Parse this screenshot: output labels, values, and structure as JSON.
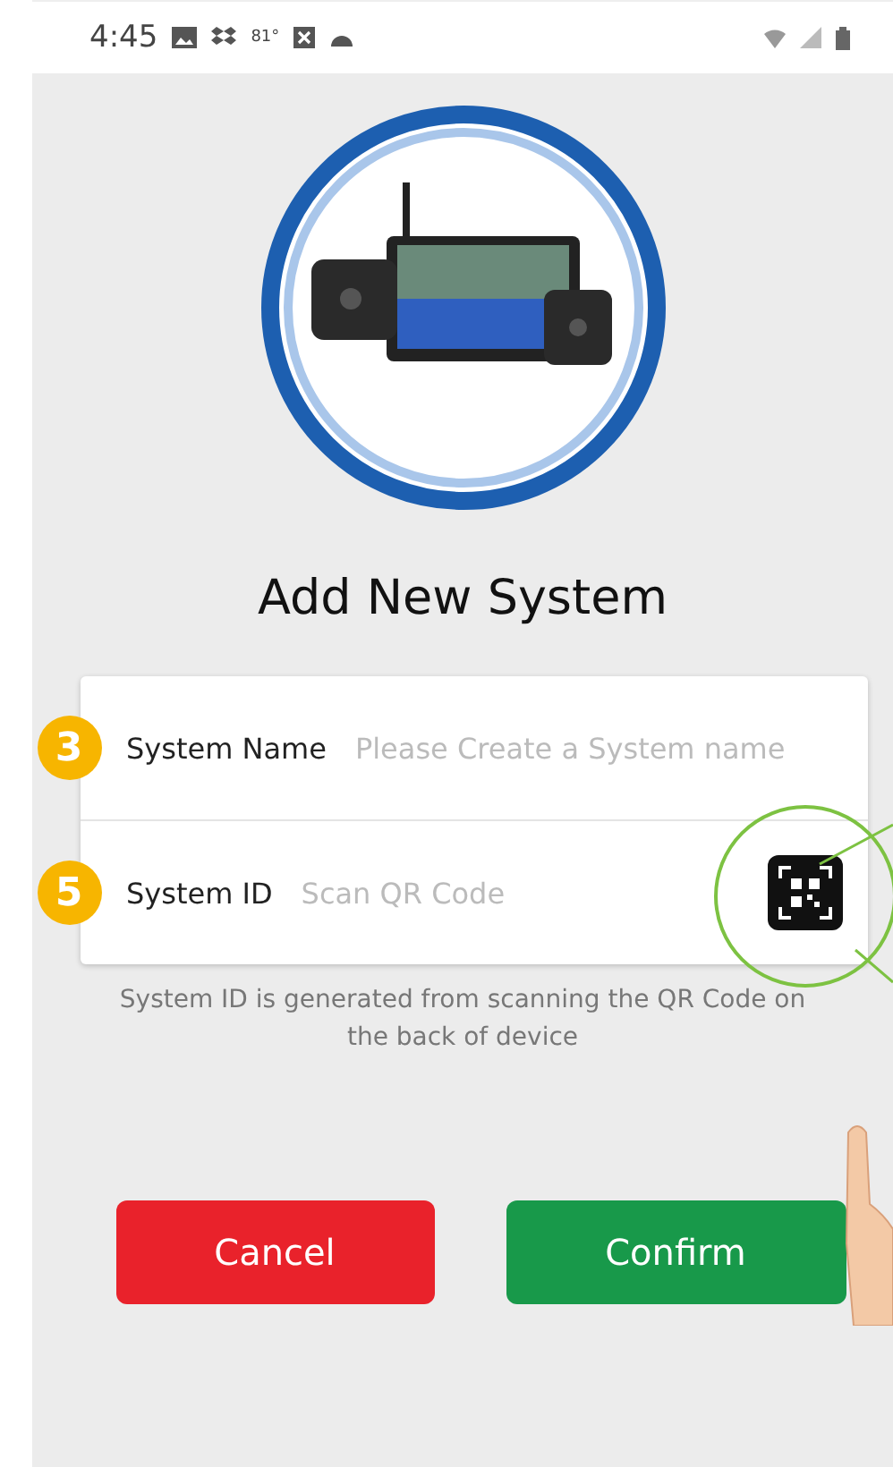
{
  "status_bar": {
    "time": "4:45",
    "temperature": "81°"
  },
  "title": "Add New System",
  "fields": [
    {
      "label": "System Name",
      "placeholder": "Please Create a System name",
      "step": "3",
      "kind": "text"
    },
    {
      "label": "System ID",
      "placeholder": "Scan QR Code",
      "step": "5",
      "kind": "qr"
    }
  ],
  "hint": "System ID is generated from scanning the QR Code on the back of device",
  "buttons": [
    {
      "label": "Cancel",
      "kind": "cancel"
    },
    {
      "label": "Confirm",
      "kind": "confirm"
    }
  ]
}
